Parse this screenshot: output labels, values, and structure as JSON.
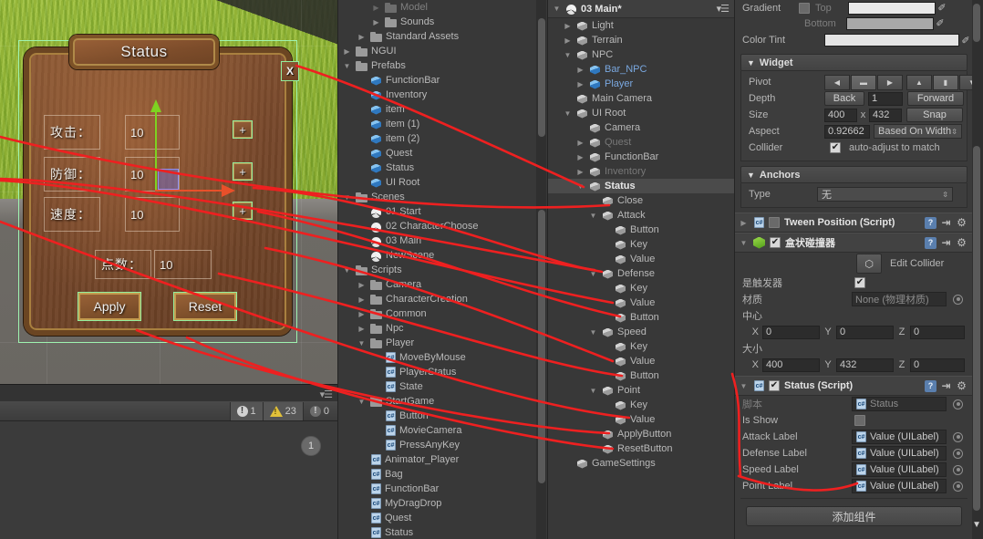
{
  "game_view": {
    "panel_title": "Status",
    "close_label": "X",
    "rows": [
      {
        "label": "攻击：",
        "value": "10",
        "plus": "+"
      },
      {
        "label": "防御：",
        "value": "10",
        "plus": "+"
      },
      {
        "label": "速度：",
        "value": "10",
        "plus": "+"
      }
    ],
    "point_label": "点数：",
    "point_value": "10",
    "apply_label": "Apply",
    "reset_label": "Reset"
  },
  "console": {
    "error_count": "1",
    "warning_count": "23",
    "info_count": "0",
    "badge": "1"
  },
  "project": {
    "items": [
      {
        "label": "Model",
        "indent": 2,
        "icon": "folder-icon",
        "twisty": "right",
        "clipped": true
      },
      {
        "label": "Sounds",
        "indent": 2,
        "icon": "folder-icon",
        "twisty": "right"
      },
      {
        "label": "Standard Assets",
        "indent": 1,
        "icon": "folder-icon",
        "twisty": "right"
      },
      {
        "label": "NGUI",
        "indent": 0,
        "icon": "folder-icon",
        "twisty": "right"
      },
      {
        "label": "Prefabs",
        "indent": 0,
        "icon": "folder-icon",
        "twisty": "down"
      },
      {
        "label": "FunctionBar",
        "indent": 1,
        "icon": "prefab-icon",
        "twisty": ""
      },
      {
        "label": "Inventory",
        "indent": 1,
        "icon": "prefab-icon",
        "twisty": ""
      },
      {
        "label": "item",
        "indent": 1,
        "icon": "prefab-icon",
        "twisty": ""
      },
      {
        "label": "item (1)",
        "indent": 1,
        "icon": "prefab-icon",
        "twisty": ""
      },
      {
        "label": "item (2)",
        "indent": 1,
        "icon": "prefab-icon",
        "twisty": ""
      },
      {
        "label": "Quest",
        "indent": 1,
        "icon": "prefab-icon",
        "twisty": ""
      },
      {
        "label": "Status",
        "indent": 1,
        "icon": "prefab-icon",
        "twisty": ""
      },
      {
        "label": "UI Root",
        "indent": 1,
        "icon": "prefab-icon",
        "twisty": ""
      },
      {
        "label": "Scenes",
        "indent": 0,
        "icon": "folder-icon",
        "twisty": "down"
      },
      {
        "label": "01 Start",
        "indent": 1,
        "icon": "scene-icon",
        "twisty": ""
      },
      {
        "label": "02 CharacterChoose",
        "indent": 1,
        "icon": "scene-icon",
        "twisty": ""
      },
      {
        "label": "03 Main",
        "indent": 1,
        "icon": "scene-icon",
        "twisty": ""
      },
      {
        "label": "NewScene",
        "indent": 1,
        "icon": "scene-icon",
        "twisty": ""
      },
      {
        "label": "Scripts",
        "indent": 0,
        "icon": "folder-icon",
        "twisty": "down"
      },
      {
        "label": "Camera",
        "indent": 1,
        "icon": "folder-icon",
        "twisty": "right"
      },
      {
        "label": "CharacterCreation",
        "indent": 1,
        "icon": "folder-icon",
        "twisty": "right"
      },
      {
        "label": "Common",
        "indent": 1,
        "icon": "folder-icon",
        "twisty": "right"
      },
      {
        "label": "Npc",
        "indent": 1,
        "icon": "folder-icon",
        "twisty": "right"
      },
      {
        "label": "Player",
        "indent": 1,
        "icon": "folder-icon",
        "twisty": "down"
      },
      {
        "label": "MoveByMouse",
        "indent": 2,
        "icon": "csharp-icon",
        "twisty": ""
      },
      {
        "label": "PlayerStatus",
        "indent": 2,
        "icon": "csharp-icon",
        "twisty": ""
      },
      {
        "label": "State",
        "indent": 2,
        "icon": "csharp-icon",
        "twisty": ""
      },
      {
        "label": "StartGame",
        "indent": 1,
        "icon": "folder-icon",
        "twisty": "down"
      },
      {
        "label": "Button",
        "indent": 2,
        "icon": "csharp-icon",
        "twisty": ""
      },
      {
        "label": "MovieCamera",
        "indent": 2,
        "icon": "csharp-icon",
        "twisty": ""
      },
      {
        "label": "PressAnyKey",
        "indent": 2,
        "icon": "csharp-icon",
        "twisty": ""
      },
      {
        "label": "Animator_Player",
        "indent": 1,
        "icon": "csharp-icon",
        "twisty": ""
      },
      {
        "label": "Bag",
        "indent": 1,
        "icon": "csharp-icon",
        "twisty": ""
      },
      {
        "label": "FunctionBar",
        "indent": 1,
        "icon": "csharp-icon",
        "twisty": ""
      },
      {
        "label": "MyDragDrop",
        "indent": 1,
        "icon": "csharp-icon",
        "twisty": ""
      },
      {
        "label": "Quest",
        "indent": 1,
        "icon": "csharp-icon",
        "twisty": ""
      },
      {
        "label": "Status",
        "indent": 1,
        "icon": "csharp-icon",
        "twisty": ""
      }
    ]
  },
  "hierarchy": {
    "scene_name": "03 Main*",
    "items": [
      {
        "label": "Light",
        "indent": 1,
        "twisty": "right",
        "style": ""
      },
      {
        "label": "Terrain",
        "indent": 1,
        "twisty": "right",
        "style": ""
      },
      {
        "label": "NPC",
        "indent": 1,
        "twisty": "down",
        "style": ""
      },
      {
        "label": "Bar_NPC",
        "indent": 2,
        "twisty": "right",
        "style": "prefab"
      },
      {
        "label": "Player",
        "indent": 2,
        "twisty": "right",
        "style": "prefab"
      },
      {
        "label": "Main Camera",
        "indent": 1,
        "twisty": "",
        "style": ""
      },
      {
        "label": "UI Root",
        "indent": 1,
        "twisty": "down",
        "style": ""
      },
      {
        "label": "Camera",
        "indent": 2,
        "twisty": "",
        "style": ""
      },
      {
        "label": "Quest",
        "indent": 2,
        "twisty": "right",
        "style": "dim"
      },
      {
        "label": "FunctionBar",
        "indent": 2,
        "twisty": "right",
        "style": ""
      },
      {
        "label": "Inventory",
        "indent": 2,
        "twisty": "right",
        "style": "dim"
      },
      {
        "label": "Status",
        "indent": 2,
        "twisty": "down",
        "style": "sel"
      },
      {
        "label": "Close",
        "indent": 3,
        "twisty": "",
        "style": ""
      },
      {
        "label": "Attack",
        "indent": 3,
        "twisty": "down",
        "style": ""
      },
      {
        "label": "Button",
        "indent": 4,
        "twisty": "",
        "style": ""
      },
      {
        "label": "Key",
        "indent": 4,
        "twisty": "",
        "style": ""
      },
      {
        "label": "Value",
        "indent": 4,
        "twisty": "",
        "style": ""
      },
      {
        "label": "Defense",
        "indent": 3,
        "twisty": "down",
        "style": ""
      },
      {
        "label": "Key",
        "indent": 4,
        "twisty": "",
        "style": ""
      },
      {
        "label": "Value",
        "indent": 4,
        "twisty": "",
        "style": ""
      },
      {
        "label": "Button",
        "indent": 4,
        "twisty": "",
        "style": ""
      },
      {
        "label": "Speed",
        "indent": 3,
        "twisty": "down",
        "style": ""
      },
      {
        "label": "Key",
        "indent": 4,
        "twisty": "",
        "style": ""
      },
      {
        "label": "Value",
        "indent": 4,
        "twisty": "",
        "style": ""
      },
      {
        "label": "Button",
        "indent": 4,
        "twisty": "",
        "style": ""
      },
      {
        "label": "Point",
        "indent": 3,
        "twisty": "down",
        "style": ""
      },
      {
        "label": "Key",
        "indent": 4,
        "twisty": "",
        "style": ""
      },
      {
        "label": "Value",
        "indent": 4,
        "twisty": "",
        "style": ""
      },
      {
        "label": "ApplyButton",
        "indent": 3,
        "twisty": "",
        "style": ""
      },
      {
        "label": "ResetButton",
        "indent": 3,
        "twisty": "",
        "style": ""
      },
      {
        "label": "GameSettings",
        "indent": 1,
        "twisty": "",
        "style": ""
      }
    ]
  },
  "inspector": {
    "gradient": {
      "label": "Gradient",
      "top_label": "Top",
      "bottom_label": "Bottom",
      "top_color": "#e9e9e9",
      "bottom_color": "#a8a8a8"
    },
    "color_tint": {
      "label": "Color Tint",
      "color": "#e4e4e4"
    },
    "widget": {
      "title": "Widget",
      "pivot_label": "Pivot",
      "depth_label": "Depth",
      "depth_back": "Back",
      "depth_value": "1",
      "depth_forward": "Forward",
      "size_label": "Size",
      "size_x": "400",
      "size_sep": "x",
      "size_y": "432",
      "snap": "Snap",
      "aspect_label": "Aspect",
      "aspect_value": "0.92662",
      "aspect_mode": "Based On Width",
      "collider_label": "Collider",
      "collider_text": "auto-adjust to match"
    },
    "anchors": {
      "title": "Anchors",
      "type_label": "Type",
      "type_value": "无"
    },
    "tween_position": {
      "title": "Tween Position (Script)"
    },
    "box_collider": {
      "title": "盒状碰撞器",
      "edit_collider": "Edit Collider",
      "is_trigger_label": "是触发器",
      "material_label": "材质",
      "material_value": "None (物理材质)",
      "center_label": "中心",
      "center": {
        "x": "0",
        "y": "0",
        "z": "0"
      },
      "size_label": "大小",
      "size": {
        "x": "400",
        "y": "432",
        "z": "0"
      },
      "axis_x": "X",
      "axis_y": "Y",
      "axis_z": "Z"
    },
    "status_script": {
      "title": "Status (Script)",
      "script_label": "脚本",
      "script_value": "Status",
      "rows": [
        {
          "label": "Is Show",
          "value": "",
          "type": "checkbox"
        },
        {
          "label": "Attack Label",
          "value": "Value (UILabel)",
          "type": "object"
        },
        {
          "label": "Defense Label",
          "value": "Value (UILabel)",
          "type": "object"
        },
        {
          "label": "Speed Label",
          "value": "Value (UILabel)",
          "type": "object"
        },
        {
          "label": "Point Label",
          "value": "Value (UILabel)",
          "type": "object"
        }
      ]
    },
    "add_component": "添加组件"
  }
}
